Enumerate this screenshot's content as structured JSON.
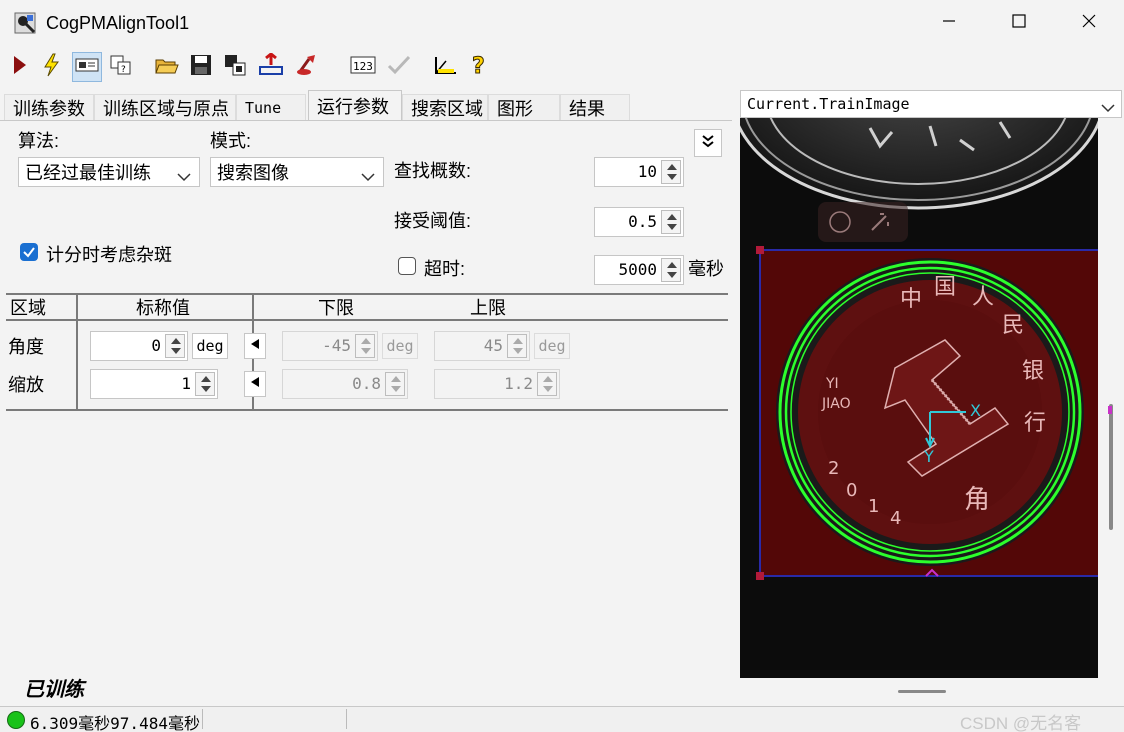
{
  "window": {
    "title": "CogPMAlignTool1",
    "controls": [
      "minimize",
      "maximize",
      "close"
    ]
  },
  "toolbar": {
    "buttons": [
      "run-icon",
      "electric-run-icon",
      "display-icon",
      "image-view-icon",
      "open-folder-icon",
      "save-icon",
      "copy-icon",
      "import-icon",
      "reset-icon",
      "numeric-display-icon",
      "grayed-check-icon",
      "measure-icon",
      "help-icon"
    ]
  },
  "tabs": [
    "训练参数",
    "训练区域与原点",
    "Tune",
    "运行参数",
    "搜索区域",
    "图形",
    "结果"
  ],
  "active_tab": "运行参数",
  "run_params": {
    "algorithm_label": "算法:",
    "algorithm_value": "已经过最佳训练",
    "mode_label": "模式:",
    "mode_value": "搜索图像",
    "find_prob_label": "查找概数:",
    "find_prob_value": "10",
    "accept_threshold_label": "接受阈值:",
    "accept_threshold_value": "0.5",
    "timeout_label": "超时:",
    "timeout_value": "5000",
    "timeout_unit": "毫秒",
    "timeout_checked": false,
    "clutter_label": "计分时考虑杂斑",
    "clutter_checked": true
  },
  "dof_table": {
    "headers": [
      "区域",
      "标称值",
      "下限",
      "上限"
    ],
    "rows": [
      {
        "name": "角度",
        "nominal": "0",
        "nominal_unit": "deg",
        "low": "-45",
        "low_unit": "deg",
        "high": "45",
        "high_unit": "deg"
      },
      {
        "name": "缩放",
        "nominal": "1",
        "nominal_unit": "",
        "low": "0.8",
        "low_unit": "",
        "high": "1.2",
        "high_unit": ""
      }
    ]
  },
  "trained_status": "已训练",
  "statusbar": {
    "status_color": "#19c219",
    "text": "6.309毫秒97.484毫秒"
  },
  "image_viewer": {
    "selected_image": "Current.TrainImage",
    "overlay_labels": {
      "x_axis": "X",
      "y_axis": "Y"
    }
  },
  "watermark": "CSDN @无名客",
  "colors": {
    "accent": "#1a6fd1",
    "region_fill": "#6b0a0a",
    "region_border": "#2a2aa8",
    "match_green": "#2cff2c",
    "origin_cyan": "#31c8d8"
  }
}
